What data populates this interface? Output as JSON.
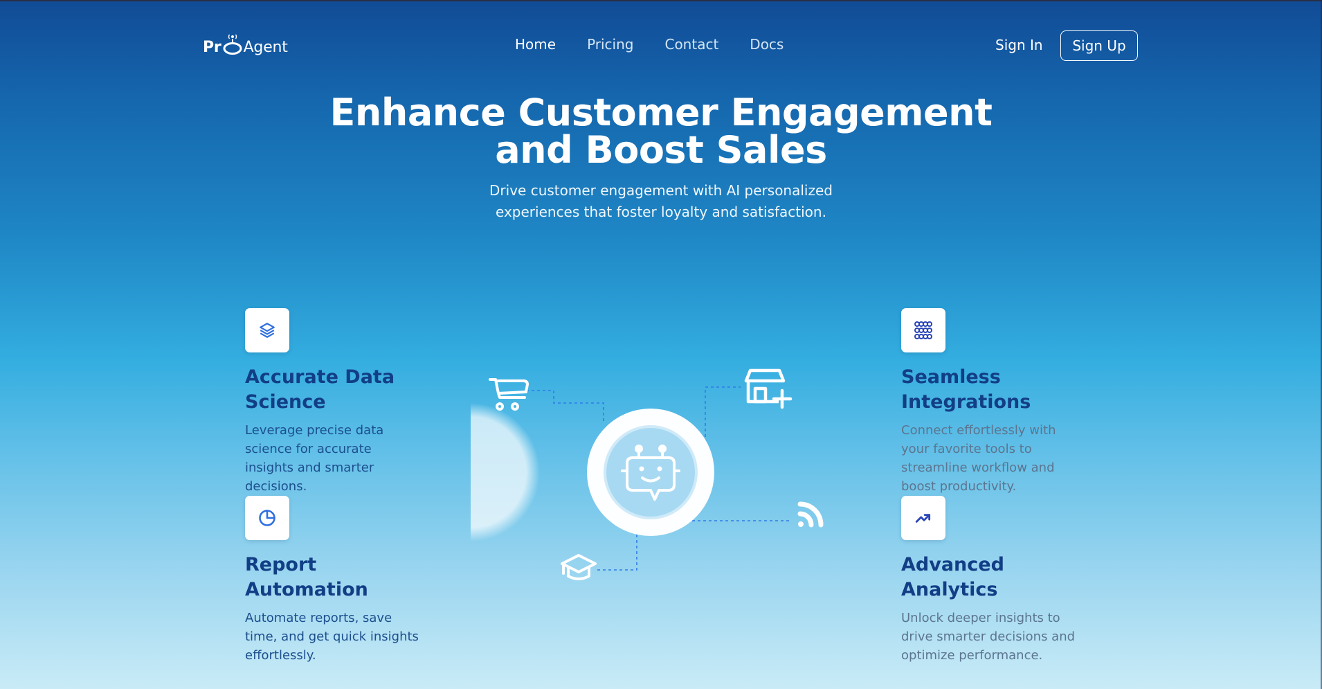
{
  "header": {
    "logo_prefix": "Pr",
    "logo_suffix": "Agent",
    "nav": [
      {
        "label": "Home",
        "active": true
      },
      {
        "label": "Pricing",
        "active": false
      },
      {
        "label": "Contact",
        "active": false
      },
      {
        "label": "Docs",
        "active": false
      }
    ],
    "sign_in": "Sign In",
    "sign_up": "Sign Up"
  },
  "hero": {
    "title_line1": "Enhance Customer Engagement",
    "title_line2": "and Boost Sales",
    "subtitle": "Drive customer engagement with AI personalized experiences that foster loyalty and satisfaction."
  },
  "features": [
    {
      "title": "Accurate Data Science",
      "description": "Leverage precise data science for accurate insights and smarter decisions.",
      "icon": "layers-icon"
    },
    {
      "title": "Seamless Integrations",
      "description": "Connect effortlessly with your favorite tools to streamline workflow and boost productivity.",
      "icon": "grid-icon"
    },
    {
      "title": "Report Automation",
      "description": "Automate reports, save time, and get quick insights effortlessly.",
      "icon": "pie-chart-icon"
    },
    {
      "title": "Advanced Analytics",
      "description": "Unlock deeper insights to drive smarter decisions and optimize performance.",
      "icon": "trending-up-icon"
    }
  ],
  "hub": {
    "center_icon": "robot-chat-icon",
    "satellites": [
      "cart-icon",
      "store-add-icon",
      "rss-icon",
      "graduation-cap-icon"
    ]
  },
  "colors": {
    "gradient_top": "#114b96",
    "gradient_mid": "#33ade0",
    "gradient_bottom": "#c9ebf7",
    "feature_title": "#123e86",
    "icon_blue": "#2f6fe0"
  }
}
